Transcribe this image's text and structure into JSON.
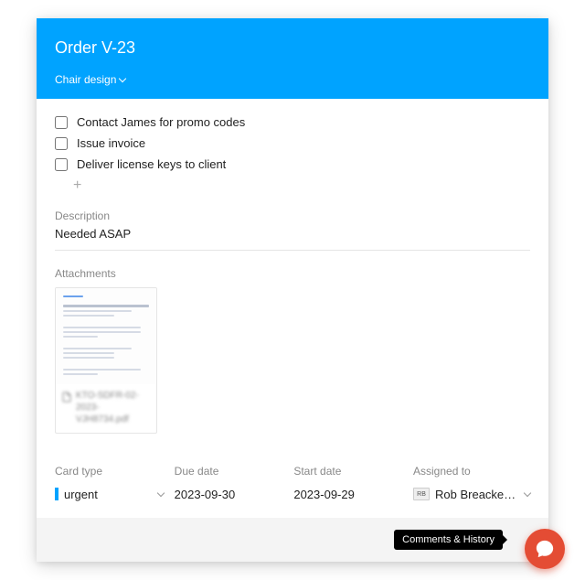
{
  "header": {
    "title": "Order V-23",
    "board": "Chair design"
  },
  "checklist": [
    {
      "label": "Contact James for promo codes",
      "checked": false
    },
    {
      "label": "Issue invoice",
      "checked": false
    },
    {
      "label": "Deliver license keys to client",
      "checked": false
    }
  ],
  "add_glyph": "+",
  "description": {
    "label": "Description",
    "value": "Needed ASAP"
  },
  "attachments": {
    "label": "Attachments",
    "items": [
      {
        "filename": "KTO-SDFR-02-2023-VJH8734.pdf"
      }
    ]
  },
  "fields": {
    "card_type": {
      "label": "Card type",
      "value": "urgent",
      "color": "#00a3ff"
    },
    "due_date": {
      "label": "Due date",
      "value": "2023-09-30"
    },
    "start_date": {
      "label": "Start date",
      "value": "2023-09-29"
    },
    "assigned_to": {
      "label": "Assigned to",
      "value": "Rob Breacken…",
      "initials": "RB"
    }
  },
  "footer": {
    "tooltip": "Comments & History"
  }
}
